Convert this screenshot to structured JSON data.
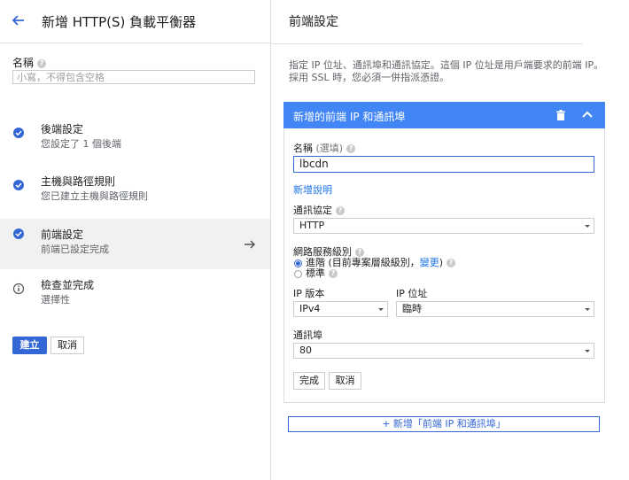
{
  "left": {
    "title": "新增 HTTP(S) 負載平衡器",
    "name_label": "名稱",
    "name_placeholder": "小寫，不得包含空格",
    "steps": [
      {
        "title": "後端設定",
        "subtitle": "您設定了 1 個後端",
        "icon": "check-icon"
      },
      {
        "title": "主機與路徑規則",
        "subtitle": "您已建立主機與路徑規則",
        "icon": "check-icon"
      },
      {
        "title": "前端設定",
        "subtitle": "前端已設定完成",
        "icon": "check-icon"
      },
      {
        "title": "檢查並完成",
        "subtitle": "選擇性",
        "icon": "info-icon"
      }
    ],
    "create_label": "建立",
    "cancel_label": "取消"
  },
  "right": {
    "title": "前端設定",
    "description": "指定 IP 位址、通訊埠和通訊協定。這個 IP 位址是用戶端要求的前端 IP。採用 SSL 時，您必須一併指派憑證。",
    "card_title": "新增的前端 IP 和通訊埠",
    "name_label": "名稱",
    "name_optional": "(選填)",
    "name_value": "lbcdn",
    "add_description": "新增說明",
    "protocol_label": "通訊協定",
    "protocol_value": "HTTP",
    "tier_label": "網路服務級別",
    "tier_premium_prefix": "進階 (目前專案層級級別，",
    "tier_change": "變更",
    "tier_premium_suffix": ")",
    "tier_standard": "標準",
    "ip_version_label": "IP 版本",
    "ip_version_value": "IPv4",
    "ip_address_label": "IP 位址",
    "ip_address_value": "臨時",
    "port_label": "通訊埠",
    "port_value": "80",
    "done_label": "完成",
    "cancel_label": "取消",
    "add_frontend": "新增「前端 IP 和通訊埠」"
  },
  "colors": {
    "accent": "#3367d6",
    "card_header": "#4285f4"
  }
}
